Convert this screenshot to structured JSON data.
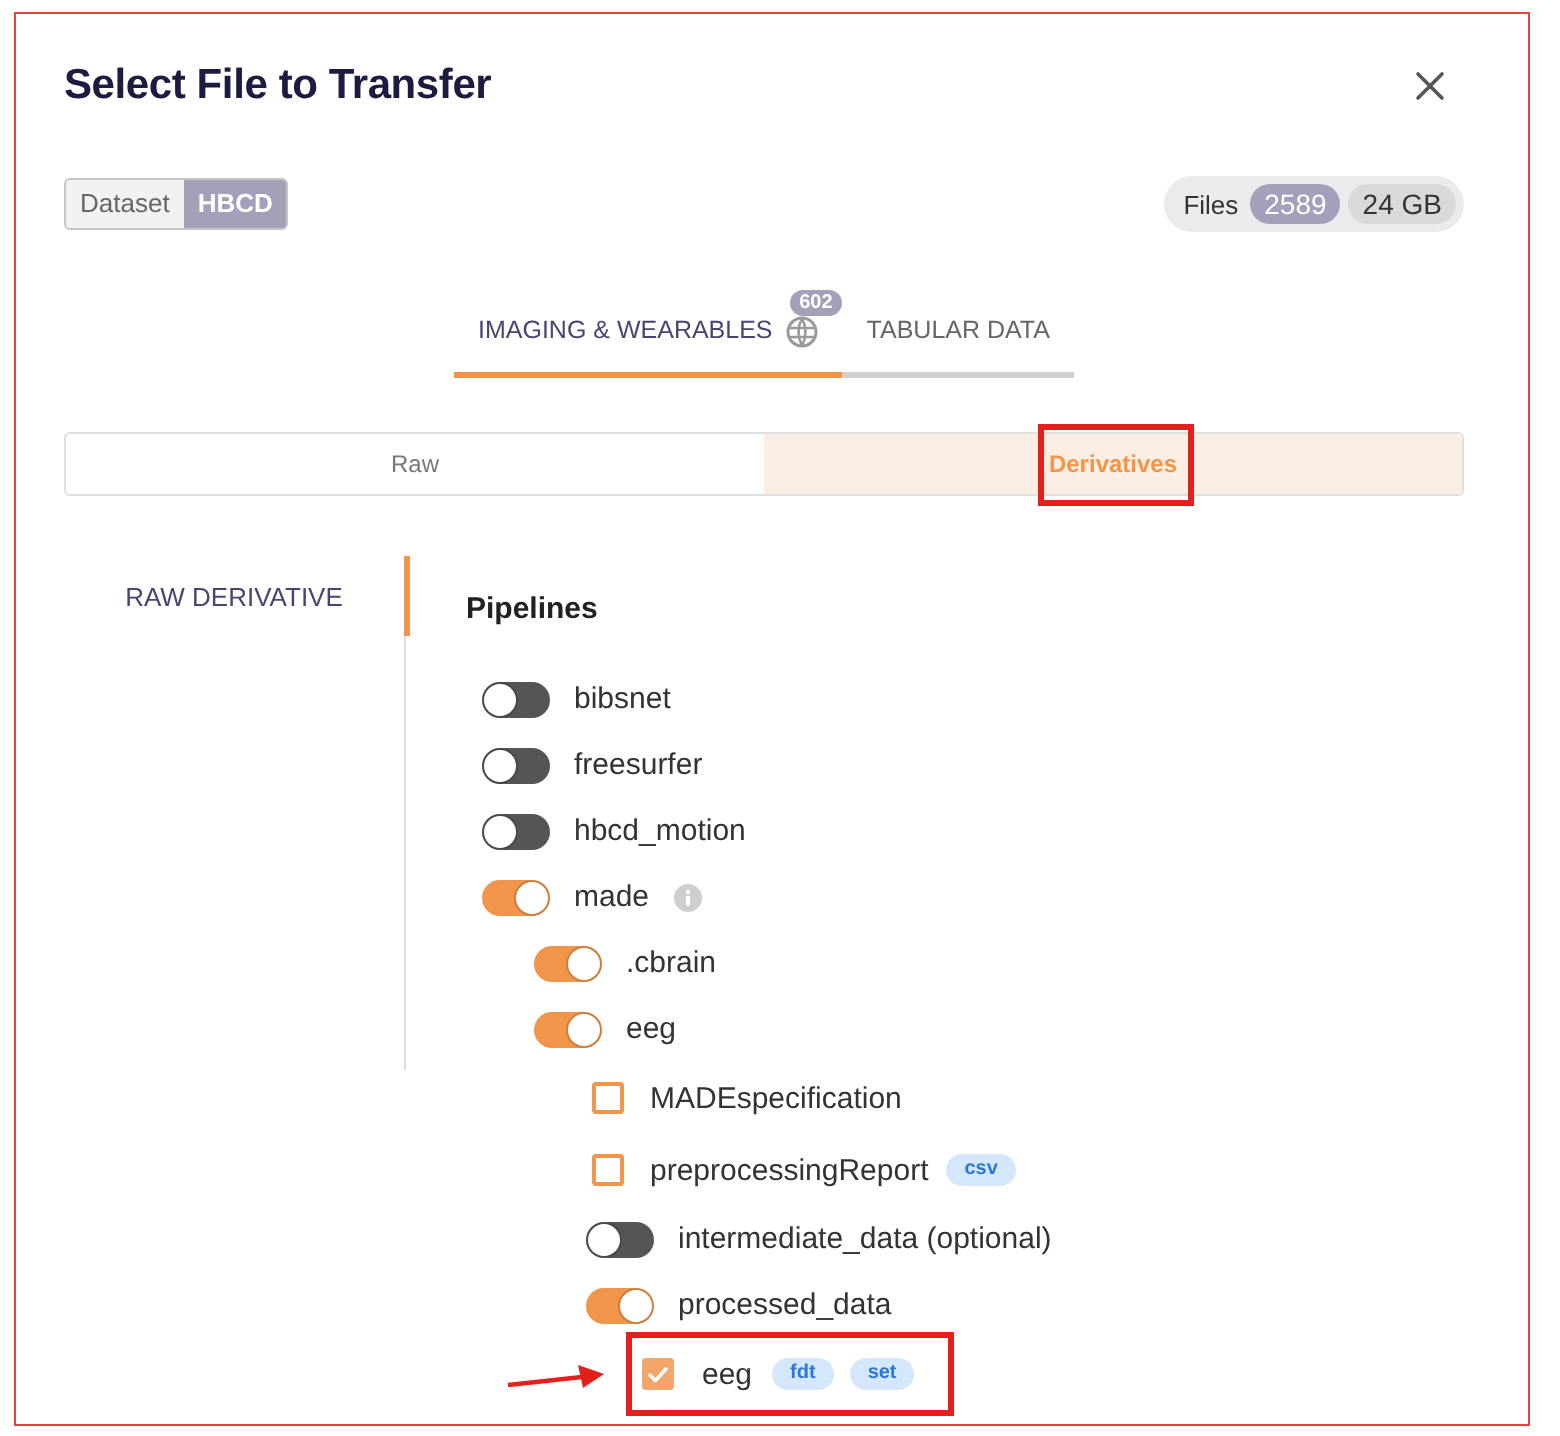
{
  "dialog": {
    "title": "Select File to Transfer"
  },
  "dataset": {
    "label": "Dataset",
    "value": "HBCD"
  },
  "files": {
    "label": "Files",
    "count": "2589",
    "size": "24 GB"
  },
  "tabs": [
    {
      "label": "IMAGING & WEARABLES",
      "badge": "602",
      "selected": true
    },
    {
      "label": "TABULAR DATA",
      "selected": false
    }
  ],
  "segments": [
    {
      "label": "Raw",
      "selected": false,
      "highlighted": false
    },
    {
      "label": "Derivatives",
      "selected": true,
      "highlighted": true
    }
  ],
  "sidebar": {
    "items": [
      {
        "label": "RAW DERIVATIVE",
        "selected": true
      }
    ]
  },
  "pipelines": {
    "title": "Pipelines",
    "items": [
      {
        "kind": "toggle",
        "label": "bibsnet",
        "on": false
      },
      {
        "kind": "toggle",
        "label": "freesurfer",
        "on": false
      },
      {
        "kind": "toggle",
        "label": "hbcd_motion",
        "on": false
      },
      {
        "kind": "toggle",
        "label": "made",
        "on": true,
        "has_info": true,
        "children": [
          {
            "kind": "toggle",
            "label": ".cbrain",
            "on": true
          },
          {
            "kind": "toggle",
            "label": "eeg",
            "on": true,
            "children": [
              {
                "kind": "checkbox",
                "label": "MADEspecification",
                "checked": false
              },
              {
                "kind": "checkbox",
                "label": "preprocessingReport",
                "checked": false,
                "tags": [
                  "csv"
                ]
              },
              {
                "kind": "toggle",
                "label": "intermediate_data (optional)",
                "on": false
              },
              {
                "kind": "toggle",
                "label": "processed_data",
                "on": true,
                "children": [
                  {
                    "kind": "checkbox",
                    "label": "eeg",
                    "checked": true,
                    "tags": [
                      "fdt",
                      "set"
                    ],
                    "highlighted": true,
                    "arrow": true
                  }
                ]
              }
            ]
          }
        ]
      }
    ]
  }
}
